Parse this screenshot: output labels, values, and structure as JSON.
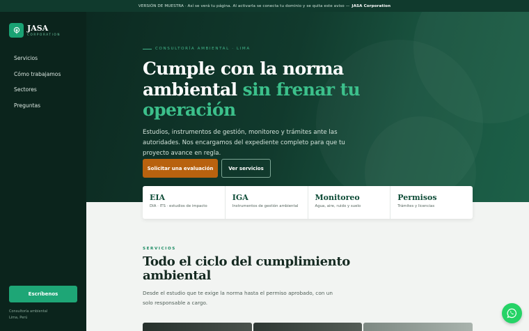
{
  "banner": {
    "text": "VERSIÓN DE MUESTRA · Así se verá tu página. Al activarla se conecta tu dominio y se quita este aviso —",
    "brand": "JASA Corporation"
  },
  "sidebar": {
    "logo_name": "JASA",
    "logo_sub": "CORPORATION",
    "nav": [
      "Servicios",
      "Cómo trabajamos",
      "Sectores",
      "Preguntas"
    ],
    "cta": "Escríbenos",
    "footer_line1": "Consultoría ambiental",
    "footer_line2": "Lima, Perú"
  },
  "hero": {
    "eyebrow": "CONSULTORÍA AMBIENTAL · LIMA",
    "title_part1": "Cumple con la norma ambiental",
    "title_part2": "sin frenar tu operación",
    "description": "Estudios, instrumentos de gestión, monitoreo y trámites ante las autoridades. Nos encargamos del expediente completo para que tu proyecto avance en regla.",
    "primary_button": "Solicitar una evaluación",
    "secondary_button": "Ver servicios"
  },
  "cards": [
    {
      "title": "EIA",
      "subtitle": "DIA · ITS · estudios de impacto"
    },
    {
      "title": "IGA",
      "subtitle": "Instrumentos de gestión ambiental"
    },
    {
      "title": "Monitoreo",
      "subtitle": "Agua, aire, ruido y suelo"
    },
    {
      "title": "Permisos",
      "subtitle": "Trámites y licencias"
    }
  ],
  "services": {
    "eyebrow": "SERVICIOS",
    "title": "Todo el ciclo del cumplimiento ambiental",
    "description": "Desde el estudio que te exige la norma hasta el permiso aprobado, con un solo responsable a cargo."
  },
  "colors": {
    "brand_dark": "#0b241c",
    "accent_green": "#1ea676",
    "accent_orange": "#b8620f",
    "whatsapp": "#25d366"
  },
  "icons": {
    "logo": "leaf-pin-icon",
    "floating": "whatsapp-icon"
  }
}
